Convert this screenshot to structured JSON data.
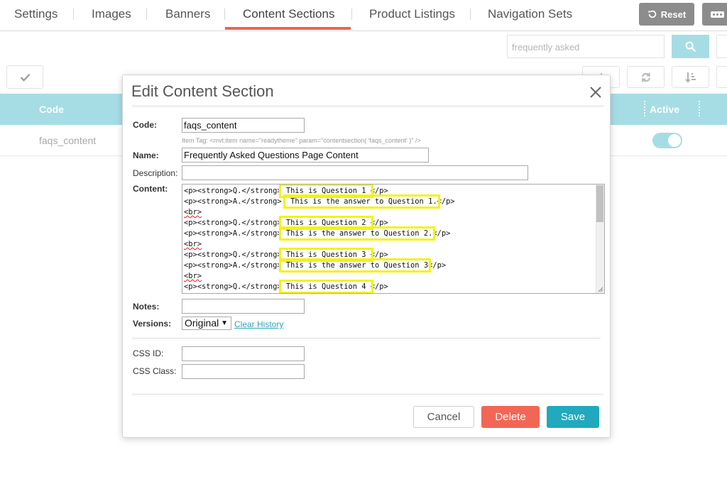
{
  "tabs": [
    {
      "label": "Settings"
    },
    {
      "label": "Images"
    },
    {
      "label": "Banners"
    },
    {
      "label": "Content Sections"
    },
    {
      "label": "Product Listings"
    },
    {
      "label": "Navigation Sets"
    }
  ],
  "active_tab": "Content Sections",
  "toolbar": {
    "reset_label": "Reset"
  },
  "search": {
    "placeholder": "frequently asked"
  },
  "table": {
    "headers": {
      "code": "Code",
      "active": "Active"
    },
    "rows": [
      {
        "code": "faqs_content",
        "active": true
      }
    ]
  },
  "modal": {
    "title": "Edit Content Section",
    "labels": {
      "code": "Code:",
      "name": "Name:",
      "description": "Description:",
      "content": "Content:",
      "notes": "Notes:",
      "versions": "Versions:",
      "css_id": "CSS ID:",
      "css_class": "CSS Class:"
    },
    "code_value": "faqs_content",
    "item_tag_hint": "Item Tag: <mvt:item name=\"readytheme\" param=\"contentsection( 'faqs_content' )\" />",
    "name_value": "Frequently Asked Questions Page Content",
    "description_value": "",
    "notes_value": "",
    "css_id_value": "",
    "css_class_value": "",
    "content_lines": [
      {
        "pre": "<p><strong>Q.</strong>",
        "hl": " This is Question 1 ",
        "post": "</p>"
      },
      {
        "pre": "<p><strong>A.</strong> ",
        "hl": " This is the answer to Question 1.",
        "post": "</p>"
      },
      {
        "br": "<br>"
      },
      {
        "pre": "<p><strong>Q.</strong>",
        "hl": " This is Question 2 ",
        "post": "</p>"
      },
      {
        "pre": "<p><strong>A.</strong>",
        "hl": " This is the answer to Question 2.",
        "post": "</p>"
      },
      {
        "br": "<br>"
      },
      {
        "pre": "<p><strong>Q.</strong>",
        "hl": " This is Question 3 ",
        "post": "</p>"
      },
      {
        "pre": "<p><strong>A.</strong>",
        "hl": " This is the answer to Question 3",
        "post": "</p>"
      },
      {
        "br": "<br>"
      },
      {
        "pre": "<p><strong>Q.</strong>",
        "hl": " This is Question 4 ",
        "post": "</p>"
      }
    ],
    "versions_selected": "Original",
    "clear_history_label": "Clear History",
    "buttons": {
      "cancel": "Cancel",
      "delete": "Delete",
      "save": "Save"
    }
  },
  "colors": {
    "accent_coral": "#f0634f",
    "teal_light": "#a6dde5",
    "teal": "#21a9bd",
    "delete_red": "#f26656",
    "highlight_yellow": "#f2f216",
    "gray_button": "#8c8c8c"
  },
  "icons": {
    "reset": "refresh-icon",
    "more": "ellipsis-icon",
    "search": "search-icon",
    "check": "checkmark-icon",
    "close": "close-icon"
  }
}
